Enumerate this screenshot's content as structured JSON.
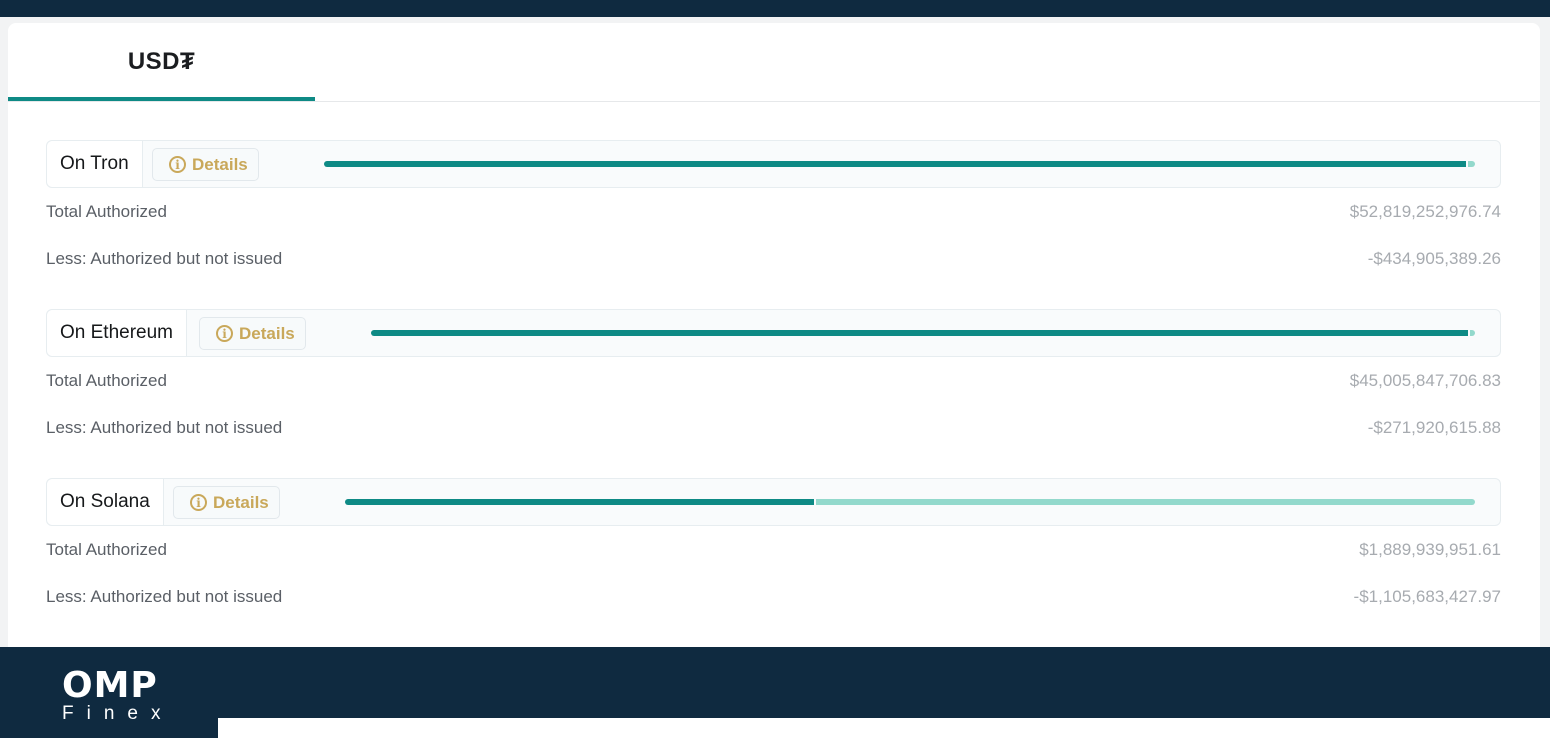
{
  "tab": {
    "label": "USD₮"
  },
  "details_label": "Details",
  "row_labels": {
    "total": "Total Authorized",
    "less": "Less: Authorized but not issued"
  },
  "chains": [
    {
      "name": "On Tron",
      "total_authorized": "$52,819,252,976.74",
      "less_not_issued": "-$434,905,389.26",
      "issued_fraction": 0.9918
    },
    {
      "name": "On Ethereum",
      "total_authorized": "$45,005,847,706.83",
      "less_not_issued": "-$271,920,615.88",
      "issued_fraction": 0.994
    },
    {
      "name": "On Solana",
      "total_authorized": "$1,889,939,951.61",
      "less_not_issued": "-$1,105,683,427.97",
      "issued_fraction": 0.415
    }
  ],
  "colors": {
    "accent": "#0e8a85",
    "unissued": "#93d9cc",
    "details": "#c9a85a",
    "navy": "#0f2a40"
  },
  "logo": {
    "main": "OMP",
    "sub": "Finex"
  }
}
